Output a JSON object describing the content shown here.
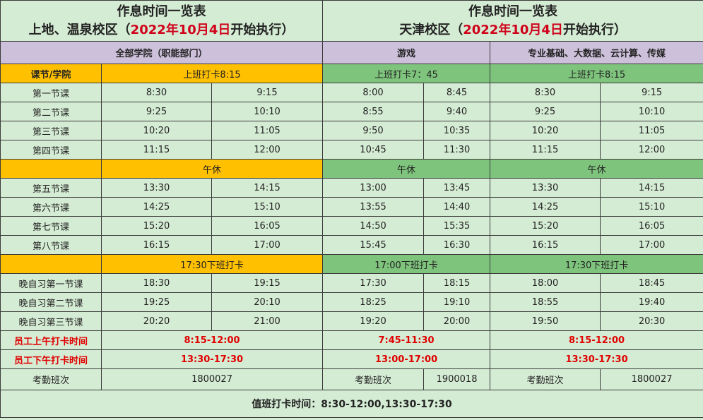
{
  "title_left": {
    "line1": "作息时间一览表",
    "line2_pre": "上地、温泉校区（",
    "line2_date": "2022年10月4日",
    "line2_post": "开始执行）"
  },
  "title_right": {
    "line1": "作息时间一览表",
    "line2_pre": "天津校区（",
    "line2_date": "2022年10月4日",
    "line2_post": "开始执行）"
  },
  "headers": {
    "all": "全部学院（职能部门）",
    "game": "游戏",
    "major": "专业基础、大数据、云计算、传媒"
  },
  "clock_in": {
    "label": "课节/学院",
    "all": "上班打卡8:15",
    "game": "上班打卡7：45",
    "major": "上班打卡8:15"
  },
  "morning": [
    {
      "label": "第一节课",
      "a": [
        "8:30",
        "9:15"
      ],
      "g": [
        "8:00",
        "8:45"
      ],
      "m": [
        "8:30",
        "9:15"
      ]
    },
    {
      "label": "第二节课",
      "a": [
        "9:25",
        "10:10"
      ],
      "g": [
        "8:55",
        "9:40"
      ],
      "m": [
        "9:25",
        "10:10"
      ]
    },
    {
      "label": "第三节课",
      "a": [
        "10:20",
        "11:05"
      ],
      "g": [
        "9:50",
        "10:35"
      ],
      "m": [
        "10:20",
        "11:05"
      ]
    },
    {
      "label": "第四节课",
      "a": [
        "11:15",
        "12:00"
      ],
      "g": [
        "10:45",
        "11:30"
      ],
      "m": [
        "11:15",
        "12:00"
      ]
    }
  ],
  "lunch": {
    "label": "",
    "all": "午休",
    "game": "午休",
    "major": "午休"
  },
  "afternoon": [
    {
      "label": "第五节课",
      "a": [
        "13:30",
        "14:15"
      ],
      "g": [
        "13:00",
        "13:45"
      ],
      "m": [
        "13:30",
        "14:15"
      ]
    },
    {
      "label": "第六节课",
      "a": [
        "14:25",
        "15:10"
      ],
      "g": [
        "13:55",
        "14:40"
      ],
      "m": [
        "14:25",
        "15:10"
      ]
    },
    {
      "label": "第七节课",
      "a": [
        "15:20",
        "16:05"
      ],
      "g": [
        "14:50",
        "15:35"
      ],
      "m": [
        "15:20",
        "16:05"
      ]
    },
    {
      "label": "第八节课",
      "a": [
        "16:15",
        "17:00"
      ],
      "g": [
        "15:45",
        "16:30"
      ],
      "m": [
        "16:15",
        "17:00"
      ]
    }
  ],
  "clock_out": {
    "label": "",
    "all": "17:30下班打卡",
    "game": "17:00下班打卡",
    "major": "17:30下班打卡"
  },
  "evening": [
    {
      "label": "晚自习第一节课",
      "a": [
        "18:30",
        "19:15"
      ],
      "g": [
        "17:30",
        "18:15"
      ],
      "m": [
        "18:00",
        "18:45"
      ]
    },
    {
      "label": "晚自习第二节课",
      "a": [
        "19:25",
        "20:10"
      ],
      "g": [
        "18:25",
        "19:10"
      ],
      "m": [
        "18:55",
        "19:40"
      ]
    },
    {
      "label": "晚自习第三节课",
      "a": [
        "20:20",
        "21:00"
      ],
      "g": [
        "19:20",
        "20:00"
      ],
      "m": [
        "19:50",
        "20:30"
      ]
    }
  ],
  "staff_am": {
    "label": "员工上午打卡时间",
    "all": "8:15-12:00",
    "game": "7:45-11:30",
    "major": "8:15-12:00"
  },
  "staff_pm": {
    "label": "员工下午打卡时间",
    "all": "13:30-17:30",
    "game": "13:00-17:00",
    "major": "13:30-17:30"
  },
  "attendance": {
    "label": "考勤班次",
    "all_code": "1800027",
    "game_label": "考勤班次",
    "game_code": "1900018",
    "major_label": "考勤班次",
    "major_code": "1800027"
  },
  "footer": "值班打卡时间：8:30-12:00,13:30-17:30"
}
